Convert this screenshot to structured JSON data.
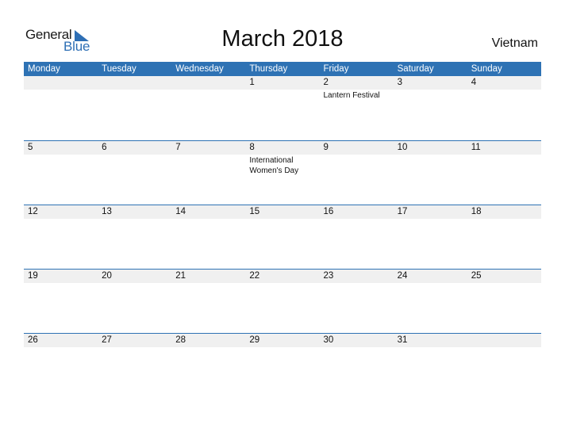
{
  "logo": {
    "line1": "General",
    "line2": "Blue",
    "accent_color": "#2e6fb5"
  },
  "header": {
    "title": "March 2018",
    "country": "Vietnam"
  },
  "calendar": {
    "header_color": "#2e72b4",
    "weekdays": [
      "Monday",
      "Tuesday",
      "Wednesday",
      "Thursday",
      "Friday",
      "Saturday",
      "Sunday"
    ],
    "weeks": [
      {
        "days": [
          "",
          "",
          "",
          "1",
          "2",
          "3",
          "4"
        ],
        "events": [
          "",
          "",
          "",
          "",
          "Lantern Festival",
          "",
          ""
        ]
      },
      {
        "days": [
          "5",
          "6",
          "7",
          "8",
          "9",
          "10",
          "11"
        ],
        "events": [
          "",
          "",
          "",
          "International Women's Day",
          "",
          "",
          ""
        ]
      },
      {
        "days": [
          "12",
          "13",
          "14",
          "15",
          "16",
          "17",
          "18"
        ],
        "events": [
          "",
          "",
          "",
          "",
          "",
          "",
          ""
        ]
      },
      {
        "days": [
          "19",
          "20",
          "21",
          "22",
          "23",
          "24",
          "25"
        ],
        "events": [
          "",
          "",
          "",
          "",
          "",
          "",
          ""
        ]
      },
      {
        "days": [
          "26",
          "27",
          "28",
          "29",
          "30",
          "31",
          ""
        ],
        "events": [
          "",
          "",
          "",
          "",
          "",
          "",
          ""
        ]
      }
    ]
  }
}
